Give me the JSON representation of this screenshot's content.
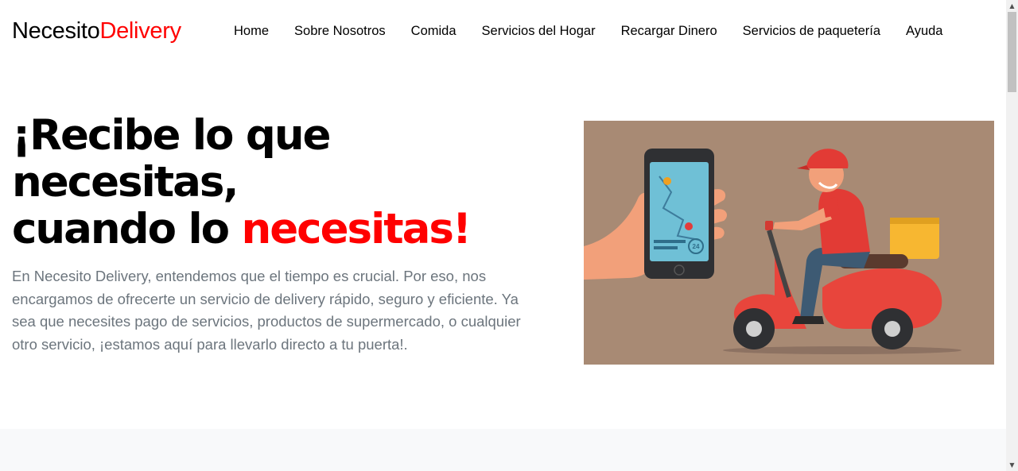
{
  "brand": {
    "part1": "Necesito",
    "part2": "Delivery",
    "accent_color": "#ff0000"
  },
  "nav": {
    "items": [
      {
        "label": "Home"
      },
      {
        "label": "Sobre Nosotros"
      },
      {
        "label": "Comida"
      },
      {
        "label": "Servicios del Hogar"
      },
      {
        "label": "Recargar Dinero"
      },
      {
        "label": "Servicios de paquetería"
      },
      {
        "label": "Ayuda"
      }
    ]
  },
  "hero": {
    "title_line1": "¡Recibe lo que",
    "title_line2": "necesitas,",
    "title_line3_prefix": "cuando lo ",
    "title_line3_accent": "necesitas!",
    "description": "En Necesito Delivery, entendemos que el tiempo es crucial. Por eso, nos encargamos de ofrecerte un servicio de delivery rápido, seguro y eficiente. Ya sea que necesites pago de servicios, productos de supermercado, o cualquier otro servicio, ¡estamos aquí para llevarlo directo a tu puerta!.",
    "image_badge": "24",
    "image_bg_color": "#a88a74"
  },
  "colors": {
    "text_muted": "#6c757d",
    "section_bg": "#f8f9fa"
  }
}
